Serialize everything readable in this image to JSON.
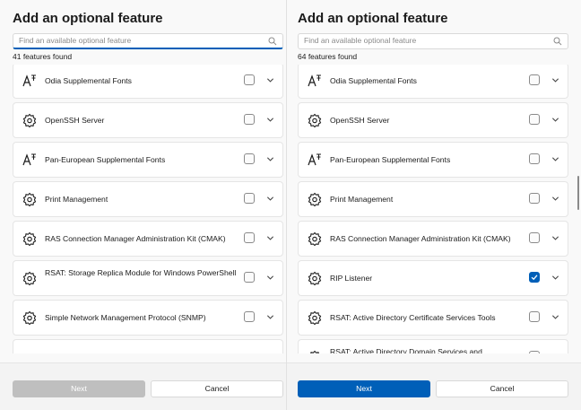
{
  "left": {
    "title": "Add an optional feature",
    "search_placeholder": "Find an available optional feature",
    "found": "41 features found",
    "items": [
      {
        "label": "Odia Supplemental Fonts",
        "icon": "font-icon",
        "checked": false
      },
      {
        "label": "OpenSSH Server",
        "icon": "gear-icon",
        "checked": false
      },
      {
        "label": "Pan-European Supplemental Fonts",
        "icon": "font-icon",
        "checked": false
      },
      {
        "label": "Print Management",
        "icon": "gear-icon",
        "checked": false
      },
      {
        "label": "RAS Connection Manager Administration Kit (CMAK)",
        "icon": "gear-icon",
        "checked": false
      },
      {
        "label": "RSAT: Storage Replica Module for Windows PowerShell",
        "icon": "gear-icon",
        "checked": false
      },
      {
        "label": "Simple Network Management Protocol (SNMP)",
        "icon": "gear-icon",
        "checked": false
      }
    ],
    "next_label": "Next",
    "cancel_label": "Cancel"
  },
  "right": {
    "title": "Add an optional feature",
    "search_placeholder": "Find an available optional feature",
    "found": "64 features found",
    "items": [
      {
        "label": "Odia Supplemental Fonts",
        "icon": "font-icon",
        "checked": false
      },
      {
        "label": "OpenSSH Server",
        "icon": "gear-icon",
        "checked": false
      },
      {
        "label": "Pan-European Supplemental Fonts",
        "icon": "font-icon",
        "checked": false
      },
      {
        "label": "Print Management",
        "icon": "gear-icon",
        "checked": false
      },
      {
        "label": "RAS Connection Manager Administration Kit (CMAK)",
        "icon": "gear-icon",
        "checked": false
      },
      {
        "label": "RIP Listener",
        "icon": "gear-icon",
        "checked": true
      },
      {
        "label": "RSAT: Active Directory Certificate Services Tools",
        "icon": "gear-icon",
        "checked": false
      },
      {
        "label": "RSAT: Active Directory Domain Services and",
        "icon": "gear-icon",
        "checked": false
      }
    ],
    "next_label": "Next",
    "cancel_label": "Cancel"
  },
  "colors": {
    "accent": "#005fb8",
    "disabled_button": "#bfbfbf",
    "background": "#f9f9f9"
  }
}
